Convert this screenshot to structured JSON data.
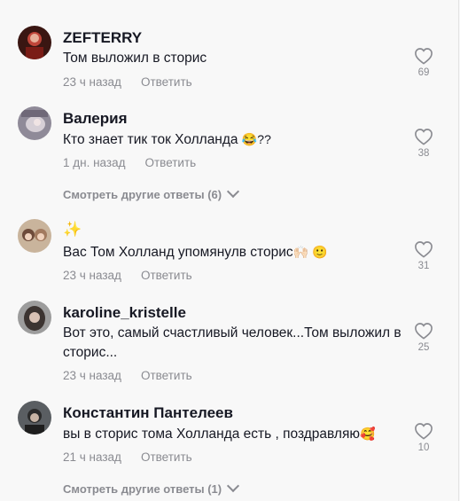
{
  "comments": [
    {
      "username": "ZEFTERRY",
      "text": "Том выложил в сторис",
      "time": "23 ч назад",
      "reply": "Ответить",
      "likes": "69"
    },
    {
      "username": "Валерия",
      "text": "Кто знает тик ток Холланда",
      "text_emoji": "😂??",
      "time": "1 дн. назад",
      "reply": "Ответить",
      "likes": "38"
    },
    {
      "username": "✨",
      "text": "Вас Том Холланд упомянулв сторис",
      "text_emoji": "🙌🏻 🙂",
      "time": "23 ч назад",
      "reply": "Ответить",
      "likes": "31"
    },
    {
      "username": "karoline_kristelle",
      "text": "Вот это, самый счастливый человек...Том выложил в сторис...",
      "time": "23 ч назад",
      "reply": "Ответить",
      "likes": "25"
    },
    {
      "username": "Константин Пантелеев",
      "text": "вы в сторис тома Холланда есть , поздравляю",
      "text_emoji": "🥰",
      "time": "21 ч назад",
      "reply": "Ответить",
      "likes": "10"
    }
  ],
  "more_replies": [
    {
      "label": "Смотреть другие ответы (6)"
    },
    {
      "label": "Смотреть другие ответы (1)"
    }
  ]
}
